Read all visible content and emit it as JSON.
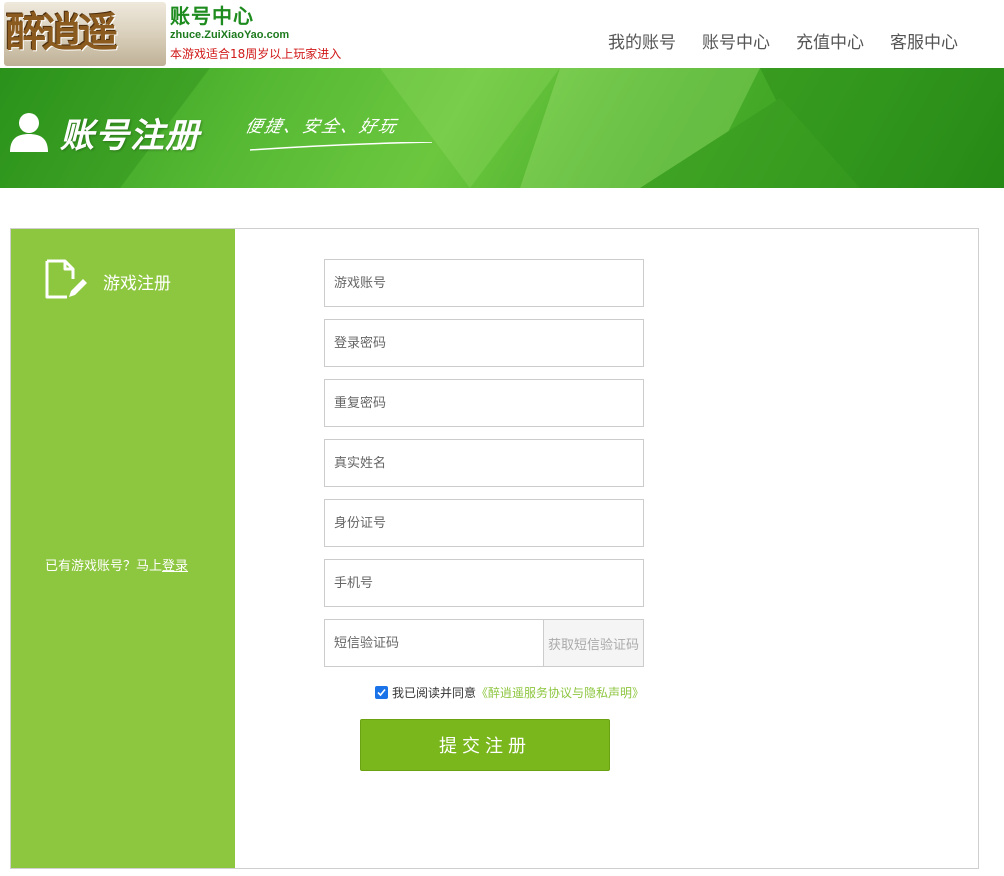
{
  "header": {
    "logo_text": "醉逍遥",
    "site_title": "账号中心",
    "site_url": "zhuce.ZuiXiaoYao.com",
    "age_notice": "本游戏适合18周岁以上玩家进入",
    "nav": [
      {
        "label": "我的账号"
      },
      {
        "label": "账号中心"
      },
      {
        "label": "充值中心"
      },
      {
        "label": "客服中心"
      }
    ]
  },
  "banner": {
    "title": "账号注册",
    "slogan": "便捷、安全、好玩"
  },
  "sidebar": {
    "title": "游戏注册",
    "login_prompt": "已有游戏账号？马上",
    "login_link": "登录"
  },
  "form": {
    "fields": [
      {
        "placeholder": "游戏账号",
        "value": ""
      },
      {
        "placeholder": "登录密码",
        "value": ""
      },
      {
        "placeholder": "重复密码",
        "value": ""
      },
      {
        "placeholder": "真实姓名",
        "value": ""
      },
      {
        "placeholder": "身份证号",
        "value": ""
      },
      {
        "placeholder": "手机号",
        "value": ""
      }
    ],
    "sms_placeholder": "短信验证码",
    "sms_button": "获取短信验证码",
    "agree_text": "我已阅读并同意",
    "agreement_link": "《醉逍遥服务协议与隐私声明》",
    "agree_checked": true,
    "submit_label": "提交注册"
  },
  "colors": {
    "accent_green": "#8dc63f",
    "button_green": "#7ab71c",
    "banner_green": "#4aae2a",
    "notice_red": "#d01818"
  },
  "icons": [
    "user-icon",
    "document-edit-icon",
    "checkbox-checked-icon"
  ]
}
